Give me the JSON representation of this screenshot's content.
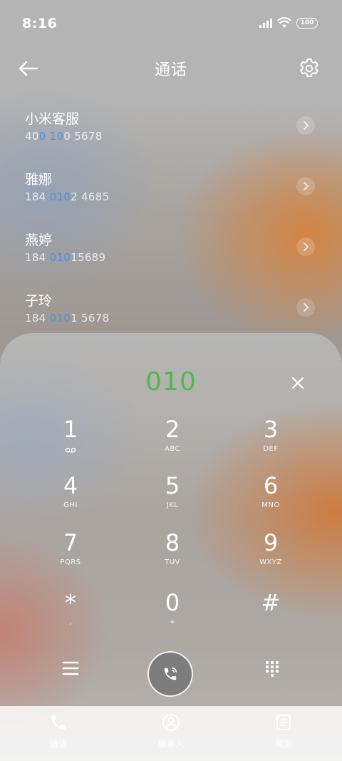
{
  "status": {
    "time": "8:16",
    "battery": "100"
  },
  "header": {
    "title": "通话"
  },
  "results": [
    {
      "name": "小米客服",
      "num_pre": "40",
      "num_hl": "0 10",
      "num_post": "0 5678"
    },
    {
      "name": "雅娜",
      "num_pre": "184 ",
      "num_hl": "010",
      "num_post": "2 4685"
    },
    {
      "name": "燕婷",
      "num_pre": "184 ",
      "num_hl": "010",
      "num_post": "15689"
    },
    {
      "name": "子玲",
      "num_pre": "184 ",
      "num_hl": "010",
      "num_post": "1 5678"
    }
  ],
  "dialpad": {
    "typed": "010",
    "keys": [
      {
        "digit": "1",
        "letters": ""
      },
      {
        "digit": "2",
        "letters": "ABC"
      },
      {
        "digit": "3",
        "letters": "DEF"
      },
      {
        "digit": "4",
        "letters": "GHI"
      },
      {
        "digit": "5",
        "letters": "JKL"
      },
      {
        "digit": "6",
        "letters": "MNO"
      },
      {
        "digit": "7",
        "letters": "PQRS"
      },
      {
        "digit": "8",
        "letters": "TUV"
      },
      {
        "digit": "9",
        "letters": "WXYZ"
      },
      {
        "digit": "*",
        "letters": ","
      },
      {
        "digit": "0",
        "letters": "+"
      },
      {
        "digit": "#",
        "letters": ""
      }
    ]
  },
  "nav": {
    "calls": "通话",
    "contacts": "联系人",
    "yellow_pages": "黄页"
  },
  "colors": {
    "match_highlight": "#4d8fdc",
    "typed_number": "#4dbb45"
  }
}
